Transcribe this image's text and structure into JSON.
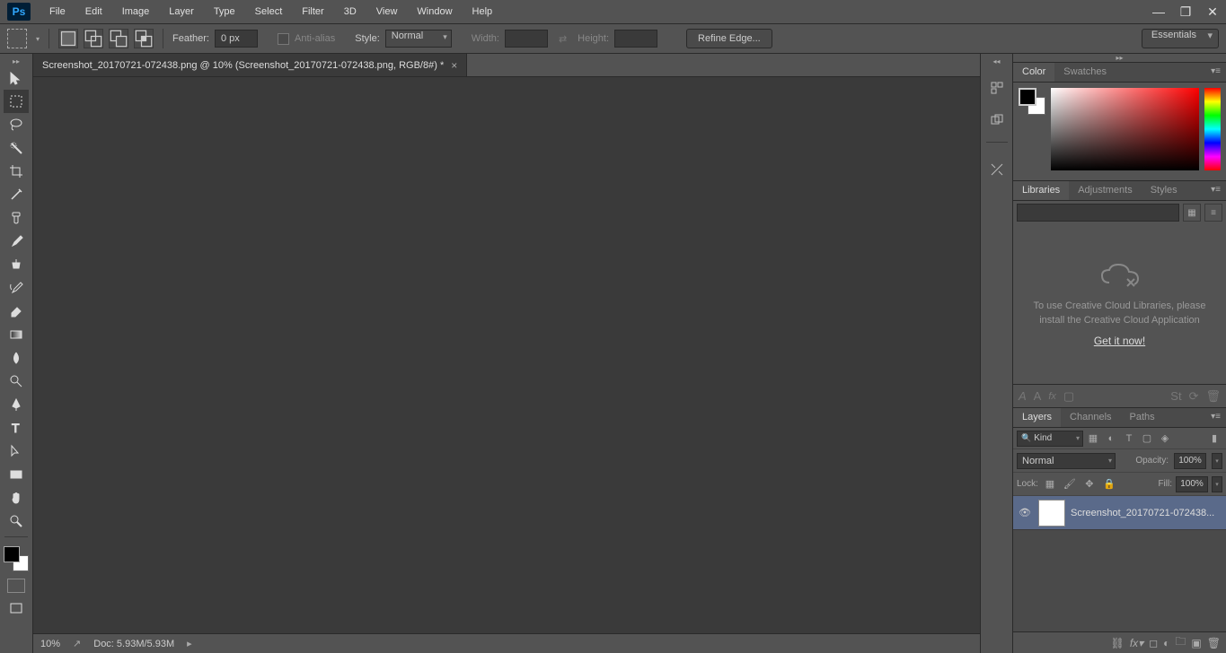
{
  "menubar": {
    "items": [
      "File",
      "Edit",
      "Image",
      "Layer",
      "Type",
      "Select",
      "Filter",
      "3D",
      "View",
      "Window",
      "Help"
    ]
  },
  "options": {
    "feather_label": "Feather:",
    "feather_value": "0 px",
    "antialias_label": "Anti-alias",
    "style_label": "Style:",
    "style_value": "Normal",
    "width_label": "Width:",
    "height_label": "Height:",
    "refine_edge": "Refine Edge...",
    "workspace": "Essentials"
  },
  "document": {
    "tab_title": "Screenshot_20170721-072438.png @ 10% (Screenshot_20170721-072438.png, RGB/8#) *"
  },
  "status": {
    "zoom": "10%",
    "doc_info": "Doc: 5.93M/5.93M"
  },
  "color_panel": {
    "tabs": [
      "Color",
      "Swatches"
    ]
  },
  "libraries_panel": {
    "tabs": [
      "Libraries",
      "Adjustments",
      "Styles"
    ],
    "message": "To use Creative Cloud Libraries, please install the Creative Cloud Application",
    "link": "Get it now!"
  },
  "layers_panel": {
    "tabs": [
      "Layers",
      "Channels",
      "Paths"
    ],
    "kind": "Kind",
    "blend_mode": "Normal",
    "opacity_label": "Opacity:",
    "opacity_value": "100%",
    "lock_label": "Lock:",
    "fill_label": "Fill:",
    "fill_value": "100%",
    "layer_name": "Screenshot_20170721-072438..."
  }
}
